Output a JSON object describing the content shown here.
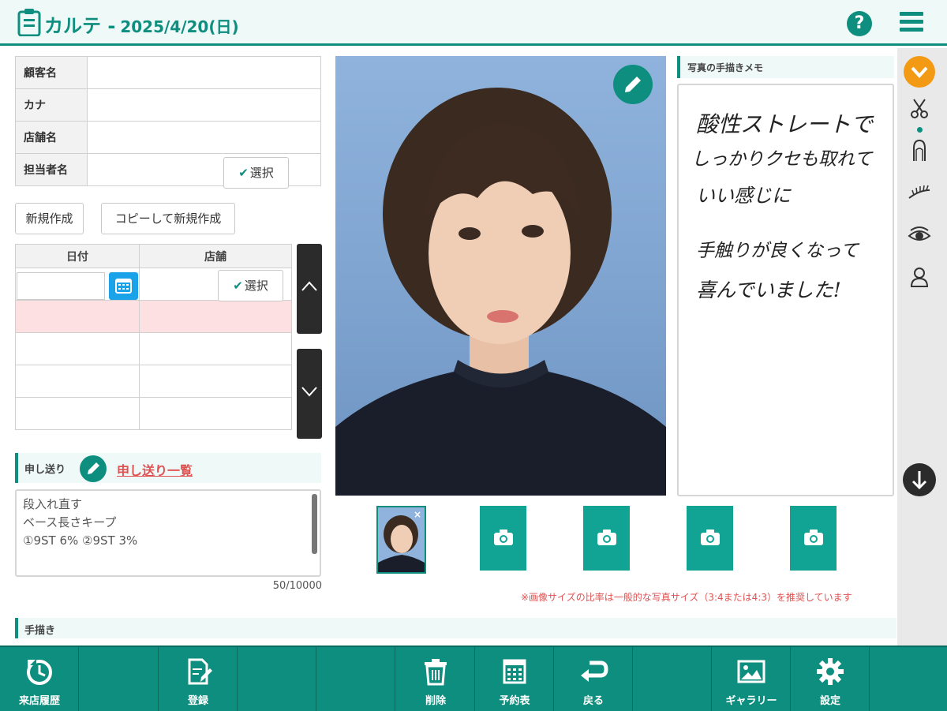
{
  "header": {
    "title": "カルテ -",
    "date": "2025/4/20(日)"
  },
  "customer": {
    "labels": [
      "顧客名",
      "カナ",
      "店舗名",
      "担当者名"
    ],
    "select_label": "選択"
  },
  "actions": {
    "new": "新規作成",
    "copy_new": "コピーして新規作成"
  },
  "visits": {
    "headers": [
      "日付",
      "店舗"
    ],
    "select_label": "選択"
  },
  "handover": {
    "label": "申し送り",
    "link": "申し送り一覧",
    "lines": [
      "段入れ直す",
      "ベース長さキープ",
      "①9ST 6% ②9ST 3%"
    ],
    "counter": "50/10000"
  },
  "handdraw": {
    "label": "手描き"
  },
  "photo_memo": {
    "label": "写真の手描きメモ",
    "lines": [
      "酸性ストレートで",
      "しっかりクセも取れて",
      "いい感じに",
      "手触りが良くなって",
      "喜んでいました!"
    ]
  },
  "photo_note": "※画像サイズの比率は一般的な写真サイズ（3:4または4:3）を推奨しています",
  "footer": {
    "history": "来店履歴",
    "register": "登録",
    "delete": "削除",
    "schedule": "予約表",
    "back": "戻る",
    "gallery": "ギャラリー",
    "settings": "設定"
  },
  "colors": {
    "primary": "#0e8e7f",
    "accent_orange": "#f39a14",
    "link_red": "#e05252",
    "selected_row": "#fde0e2"
  }
}
